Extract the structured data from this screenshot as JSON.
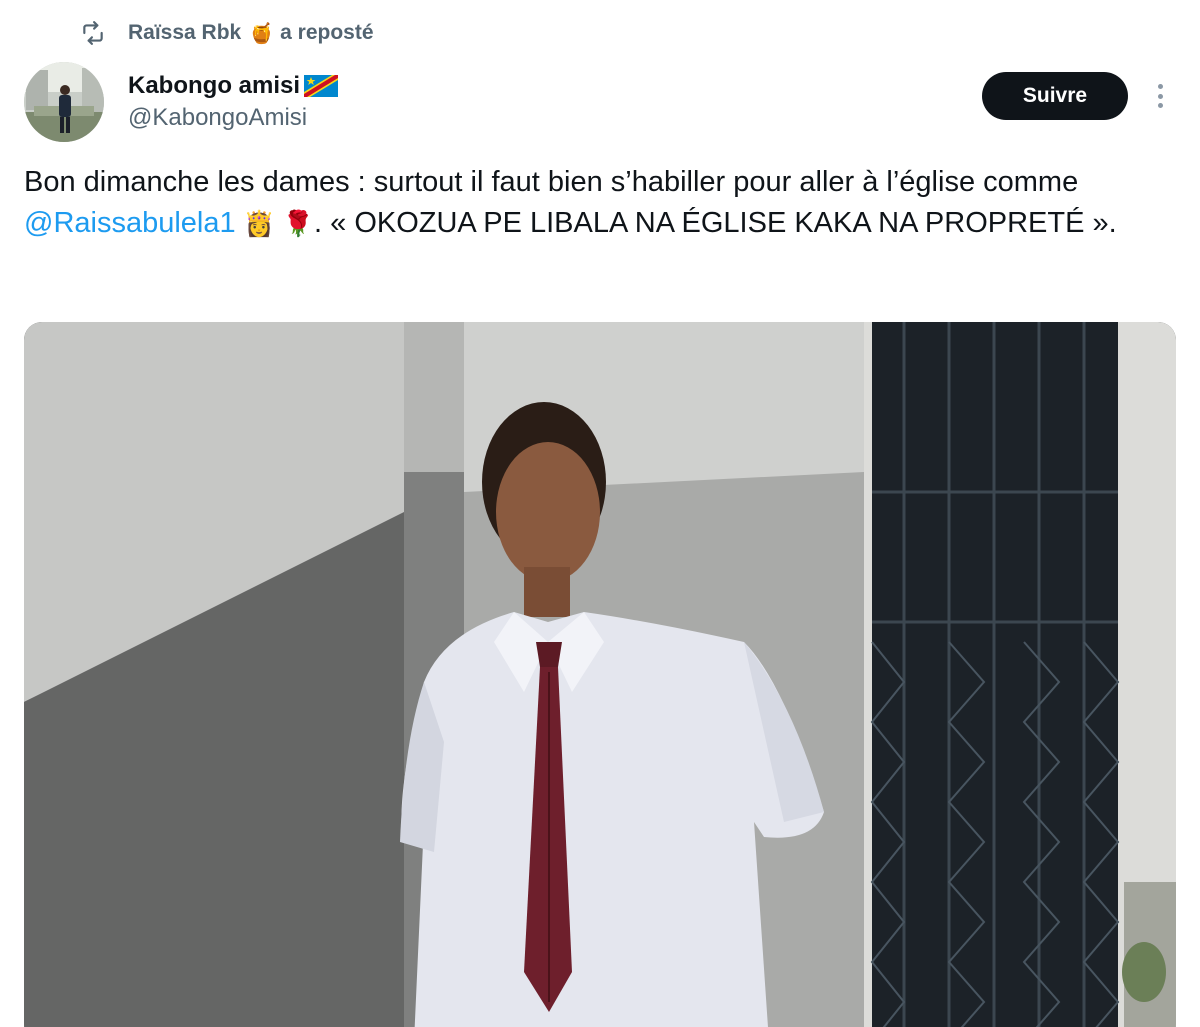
{
  "repost": {
    "icon": "repost-icon",
    "user": "Raïssa Rbk",
    "emoji": "🍯",
    "action": "a reposté"
  },
  "author": {
    "name": "Kabongo amisi",
    "flag": "drc-flag-emoji",
    "handle": "@KabongoAmisi"
  },
  "follow_label": "Suivre",
  "tweet": {
    "text_before": "Bon dimanche les dames : surtout il faut bien s’habiller pour aller à l’église comme ",
    "mention": "@Raissabulela1",
    "emoji1": "👸",
    "emoji2": "🌹",
    "text_after": ". « OKOZUA PE LIBALA NA ÉGLISE KAKA NA PROPRETÉ »."
  },
  "colors": {
    "accent": "#1d9bf0",
    "text_primary": "#0f1419",
    "text_secondary": "#536471",
    "button_bg": "#0f1419"
  }
}
